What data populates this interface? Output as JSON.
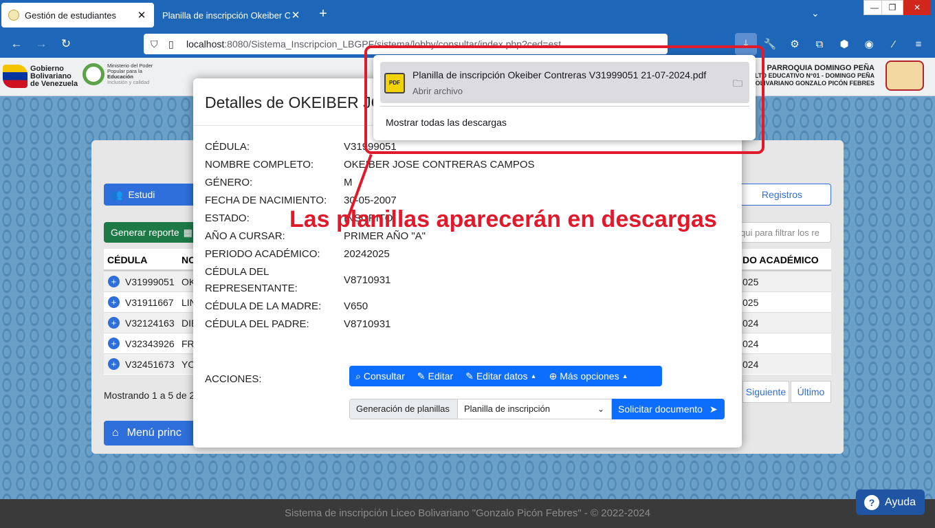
{
  "browser": {
    "tabs": [
      {
        "label": "Gestión de estudiantes",
        "active": true
      },
      {
        "label": "Planilla de inscripción Okeiber Cont",
        "active": false
      }
    ],
    "new_tab_icon": "plus-icon",
    "url_host": "localhost",
    "url_path": ":8080/Sistema_Inscripcion_LBGPF/sistema/lobby/consultar/index.php?ced=est",
    "window_controls": [
      "minimize",
      "restore",
      "close"
    ]
  },
  "header": {
    "gov_logo_text": [
      "Gobierno",
      "Bolivariano",
      "de Venezuela"
    ],
    "ministry_text": [
      "Ministerio del Poder",
      "Popular para la",
      "Educación",
      "Inclusión y calidad"
    ],
    "school_lines": [
      "PARROQUIA DOMINGO PEÑA",
      "CULTO EDUCATIVO N°01 - DOMINGO PEÑA",
      "O BOLIVARIANO GONZALO PICÓN FEBRES"
    ]
  },
  "background": {
    "students_button": "Estudi",
    "records_button": "Registros",
    "report_button": "Generar reporte",
    "filter_placeholder": "qui para filtrar los re",
    "table_headers": [
      "CÉDULA",
      "NO",
      "DO ACADÉMICO"
    ],
    "rows": [
      {
        "cedula": "V31999051",
        "name": "OK",
        "periodo": "025"
      },
      {
        "cedula": "V31911667",
        "name": "LIN",
        "periodo": "025"
      },
      {
        "cedula": "V32124163",
        "name": "DIE",
        "periodo": "024"
      },
      {
        "cedula": "V32343926",
        "name": "FRA",
        "periodo": "024"
      },
      {
        "cedula": "V32451673",
        "name": "YO",
        "periodo": "024"
      }
    ],
    "showing": "Mostrando 1 a 5 de 2",
    "pagination": [
      "Siguiente",
      "Último"
    ],
    "menu_button": "Menú princ"
  },
  "modal": {
    "title": "Detalles de OKEIBER JO",
    "details": [
      {
        "label": "CÉDULA:",
        "value": "V31999051"
      },
      {
        "label": "NOMBRE COMPLETO:",
        "value": "OKEIBER JOSE CONTRERAS CAMPOS"
      },
      {
        "label": "GÉNERO:",
        "value": "M"
      },
      {
        "label": "FECHA DE NACIMIENTO:",
        "value": "30-05-2007"
      },
      {
        "label": "ESTADO:",
        "value": "INSCRITO"
      },
      {
        "label": "AÑO A CURSAR:",
        "value": "PRIMER AÑO \"A\""
      },
      {
        "label": "PERIODO ACADÉMICO:",
        "value": "20242025"
      },
      {
        "label": "CÉDULA DEL",
        "label2": "REPRESENTANTE:",
        "value": "V8710931"
      },
      {
        "label": "CÉDULA DE LA MADRE:",
        "value": "V650"
      },
      {
        "label": "CÉDULA DEL PADRE:",
        "value": "V8710931"
      }
    ],
    "actions_label": "ACCIONES:",
    "action_buttons": [
      "Consultar",
      "Editar",
      "Editar datos",
      "Más opciones"
    ],
    "planillas_label": "Generación de planillas",
    "planillas_selected": "Planilla de inscripción",
    "request_button": "Solicitar documento"
  },
  "downloads": {
    "file_name": "Planilla de inscripción Okeiber Contreras V31999051 21-07-2024.pdf",
    "file_action": "Abrir archivo",
    "show_all": "Mostrar todas las descargas"
  },
  "annotation": {
    "text": "Las planillas aparecerán en descargas",
    "color": "#e0192b"
  },
  "footer": {
    "text": "Sistema de inscripción Liceo Bolivariano \"Gonzalo Picón Febres\" - © 2022-2024",
    "help": "Ayuda"
  }
}
